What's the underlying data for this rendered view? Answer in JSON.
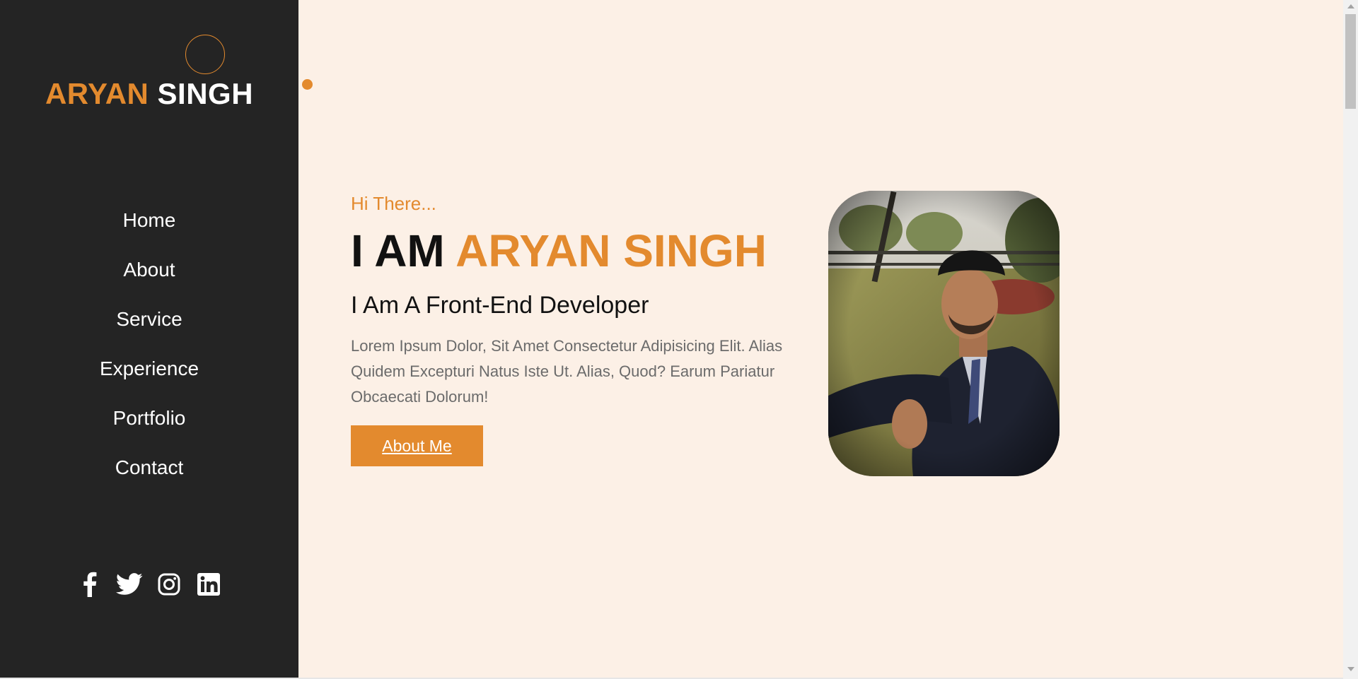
{
  "logo": {
    "first": "ARYAN",
    "last": "SINGH"
  },
  "nav": {
    "items": [
      {
        "label": "Home"
      },
      {
        "label": "About"
      },
      {
        "label": "Service"
      },
      {
        "label": "Experience"
      },
      {
        "label": "Portfolio"
      },
      {
        "label": "Contact"
      }
    ]
  },
  "social": {
    "icons": [
      "facebook-icon",
      "twitter-icon",
      "instagram-icon",
      "linkedin-icon"
    ]
  },
  "hero": {
    "greeting": "Hi There...",
    "headline_prefix": "I AM",
    "headline_name": "ARYAN SINGH",
    "role": "I Am A Front-End Developer",
    "description": "Lorem Ipsum Dolor, Sit Amet Consectetur Adipisicing Elit. Alias Quidem Excepturi Natus Iste Ut. Alias, Quod? Earum Pariatur Obcaecati Dolorum!",
    "button_label": "About Me"
  },
  "colors": {
    "accent": "#e38a2e",
    "sidebar": "#242424",
    "background": "#fcf0e6"
  }
}
